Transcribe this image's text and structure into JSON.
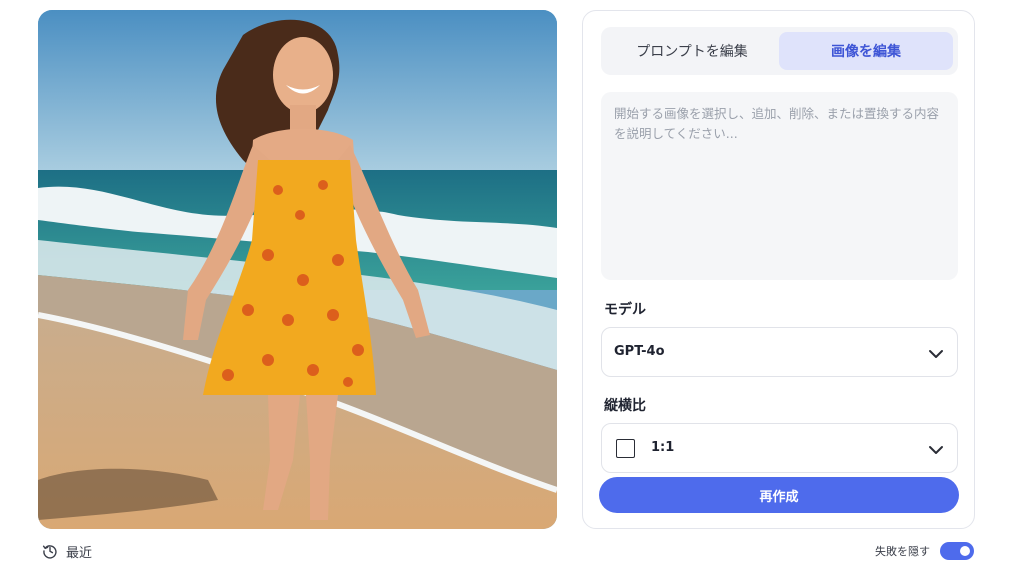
{
  "image": {
    "alt_icon": "generated-image",
    "colors": {
      "sky": "#5f9dc8",
      "sea": "#1d7f86",
      "sand": "#d8b48a",
      "dress": "#f2a91f"
    }
  },
  "editor": {
    "tabs": [
      {
        "label": "プロンプトを編集",
        "active": false
      },
      {
        "label": "画像を編集",
        "active": true
      }
    ],
    "prompt": {
      "value": "",
      "placeholder": "開始する画像を選択し、追加、削除、または置換する内容を説明してください..."
    },
    "model": {
      "label": "モデル",
      "value": "GPT-4o"
    },
    "aspect_ratio": {
      "label": "縦横比",
      "value": "1:1"
    },
    "regenerate_label": "再作成"
  },
  "footer": {
    "recent_label": "最近",
    "hide_failed_label": "失敗を隠す",
    "hide_failed_on": true
  },
  "colors": {
    "accent": "#4e6bec",
    "tab_active_bg": "#dfe3fb",
    "tab_active_text": "#3e55d6"
  }
}
